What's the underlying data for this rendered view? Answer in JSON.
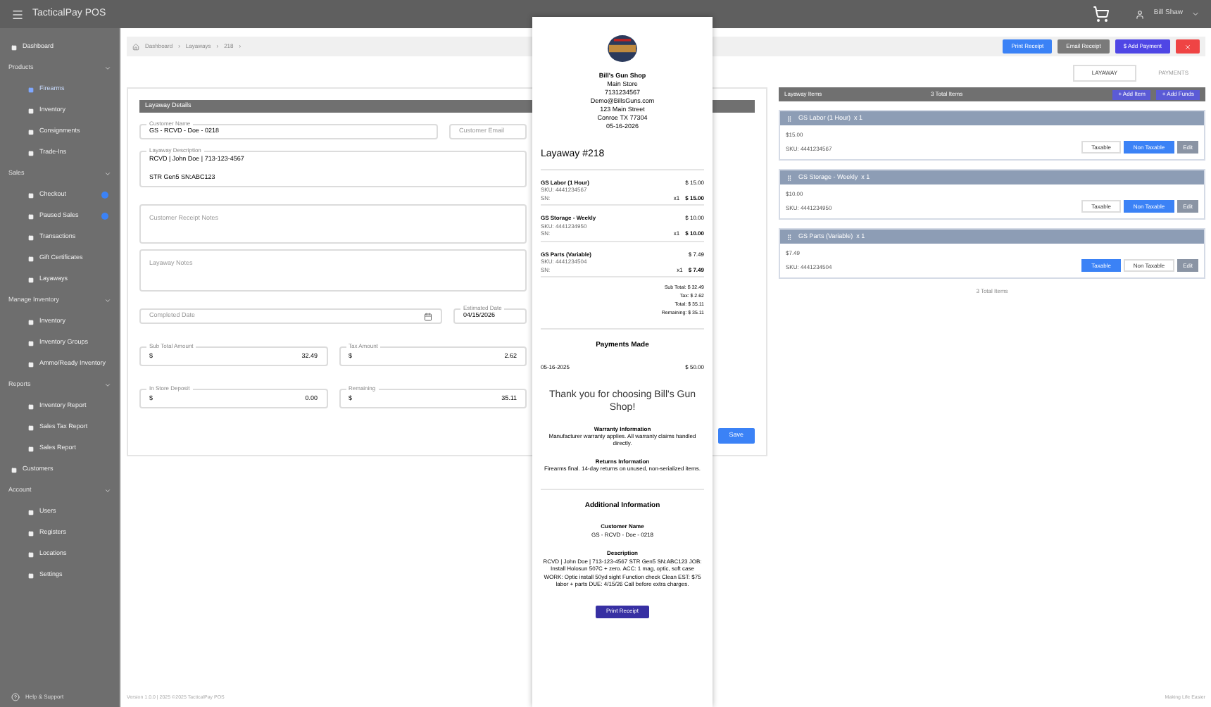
{
  "app": {
    "title": "TacticalPay POS",
    "user": "Bill Shaw"
  },
  "sidebar": {
    "items": [
      {
        "kind": "link",
        "label": "Dashboard",
        "selected": false
      },
      {
        "kind": "section",
        "label": "Products",
        "expanded": true,
        "children": [
          {
            "label": "Firearms",
            "selected": true
          },
          {
            "label": "Inventory",
            "selected": false
          },
          {
            "label": "Consignments",
            "selected": false
          },
          {
            "label": "Trade-Ins",
            "selected": false
          }
        ]
      },
      {
        "kind": "section",
        "label": "Sales",
        "expanded": true,
        "children": [
          {
            "label": "Checkout",
            "selected": false,
            "color": "#3b82f6"
          },
          {
            "label": "Paused Sales",
            "selected": false,
            "color": "#3b82f6"
          },
          {
            "label": "Transactions",
            "selected": false
          },
          {
            "label": "Gift Certificates",
            "selected": false
          },
          {
            "label": "Layaways",
            "selected": false
          }
        ]
      },
      {
        "kind": "section",
        "label": "Manage Inventory",
        "expanded": true,
        "children": [
          {
            "label": "Inventory",
            "selected": false
          },
          {
            "label": "Inventory Groups",
            "selected": false
          },
          {
            "label": "Ammo/Ready Inventory",
            "selected": false
          }
        ]
      },
      {
        "kind": "section",
        "label": "Reports",
        "expanded": true,
        "children": [
          {
            "label": "Inventory Report",
            "selected": false
          },
          {
            "label": "Sales Tax Report",
            "selected": false
          },
          {
            "label": "Sales Report",
            "selected": false
          }
        ]
      },
      {
        "kind": "link",
        "label": "Customers",
        "selected": false
      },
      {
        "kind": "section",
        "label": "Account",
        "expanded": true,
        "children": [
          {
            "label": "Users",
            "selected": false
          },
          {
            "label": "Registers",
            "selected": false
          },
          {
            "label": "Locations",
            "selected": false
          },
          {
            "label": "Settings",
            "selected": false
          }
        ]
      }
    ],
    "footer": "Help & Support"
  },
  "breadcrumb": {
    "items": [
      {
        "label": "Dashboard",
        "separator": "›"
      },
      {
        "label": "Layaways",
        "separator": "›"
      },
      {
        "label": "218",
        "separator": "›"
      }
    ]
  },
  "actions": [
    {
      "kind": "primary",
      "label": "Print Receipt"
    },
    {
      "kind": "secondary",
      "label": "Email Receipt"
    },
    {
      "kind": "payment",
      "label": "$ Add Payment"
    },
    {
      "kind": "danger"
    }
  ],
  "tabs": [
    {
      "label": "LAYAWAY",
      "selected": true
    },
    {
      "label": "PAYMENTS",
      "selected": false
    }
  ],
  "details": {
    "title": "Layaway Details",
    "customer_name": {
      "label": "Customer Name",
      "value": "GS - RCVD - Doe - 0218"
    },
    "customer_email": {
      "placeholder": "Customer Email"
    },
    "description": {
      "label": "Layaway Description",
      "lines": [
        "RCVD | John Doe | 713-123-4567",
        "STR Gen5 SN:ABC123"
      ]
    },
    "receipt_notes": {
      "placeholder": "Customer Receipt Notes"
    },
    "layaway_notes": {
      "placeholder": "Layaway Notes"
    },
    "completed_date": {
      "placeholder": "Completed Date"
    },
    "estimated_date": {
      "label": "Estimated Date",
      "value": "04/15/2026"
    },
    "amounts": [
      {
        "label": "Sub Total Amount",
        "prefix": "$",
        "value": "32.49"
      },
      {
        "label": "Tax Amount",
        "prefix": "$",
        "value": "2.62"
      },
      {
        "label": "In Store Deposit",
        "prefix": "$",
        "value": "0.00"
      },
      {
        "label": "Remaining",
        "prefix": "$",
        "value": "35.11"
      }
    ],
    "save": "Save"
  },
  "items_panel": {
    "title": "Layaway Items",
    "count": "3 Total Items",
    "buttons": [
      "+ Add Item",
      "+ Add Funds"
    ],
    "items": [
      {
        "title": "GS Labor (1 Hour)  x 1",
        "price": "$15.00",
        "sku": "SKU: 4441234567",
        "taxable": false,
        "taxable_label": "Taxable",
        "non_taxable_label": "Non Taxable",
        "edit_label": "Edit"
      },
      {
        "title": "GS Storage - Weekly  x 1",
        "price": "$10.00",
        "sku": "SKU: 4441234950",
        "taxable": false,
        "taxable_label": "Taxable",
        "non_taxable_label": "Non Taxable",
        "edit_label": "Edit"
      },
      {
        "title": "GS Parts (Variable)  x 1",
        "price": "$7.49",
        "sku": "SKU: 4441234504",
        "taxable": true,
        "taxable_label": "Taxable",
        "non_taxable_label": "Non Taxable",
        "edit_label": "Edit"
      }
    ],
    "footer": "3 Total Items"
  },
  "receipt": {
    "shop": [
      "Bill's Gun Shop",
      "Main Store",
      "7131234567",
      "Demo@BillsGuns.com",
      "123 Main Street",
      "Conroe TX 77304",
      "05-16-2026"
    ],
    "title": "Layaway #218",
    "items": [
      {
        "name": "GS Labor (1 Hour)",
        "price": "$ 15.00",
        "sku": "SKU: 4441234567",
        "sn": "SN:",
        "qty": "x1",
        "total": "$ 15.00"
      },
      {
        "name": "GS Storage - Weekly",
        "price": "$ 10.00",
        "sku": "SKU: 4441234950",
        "sn": "SN:",
        "qty": "x1",
        "total": "$ 10.00"
      },
      {
        "name": "GS Parts (Variable)",
        "price": "$ 7.49",
        "sku": "SKU: 4441234504",
        "sn": "SN:",
        "qty": "x1",
        "total": "$ 7.49"
      }
    ],
    "totals": [
      "Sub Total: $ 32.49",
      "Tax: $ 2.62",
      "Total: $ 35.11",
      "Remaining: $ 35.11"
    ],
    "payments_title": "Payments Made",
    "payments": [
      {
        "date": "05-16-2025",
        "amount": "$ 50.00"
      }
    ],
    "thanks": "Thank you for choosing Bill's Gun Shop!",
    "sections": [
      {
        "title": "Warranty Information",
        "text": "Manufacturer warranty applies. All warranty claims handled directly."
      },
      {
        "title": "Returns Information",
        "text": "Firearms final. 14-day returns on unused, non-serialized items."
      }
    ],
    "additional_title": "Additional Information",
    "additional": [
      {
        "title": "Customer Name",
        "text": "GS - RCVD - Doe - 0218"
      },
      {
        "title": "Description",
        "text": "RCVD | John Doe | 713-123-4567 STR Gen5 SN:ABC123 JOB: Install Holosun 507C + zero. ACC: 1 mag, optic, soft case WORK: Optic install 50yd sight Function check Clean EST: $75 labor + parts DUE: 4/15/26 Call before extra charges."
      }
    ],
    "print": "Print Receipt"
  },
  "footer": {
    "left": "Version 1.0.0 | 2025 ©2025 TacticalPay POS",
    "right": "Making Life Easier"
  }
}
